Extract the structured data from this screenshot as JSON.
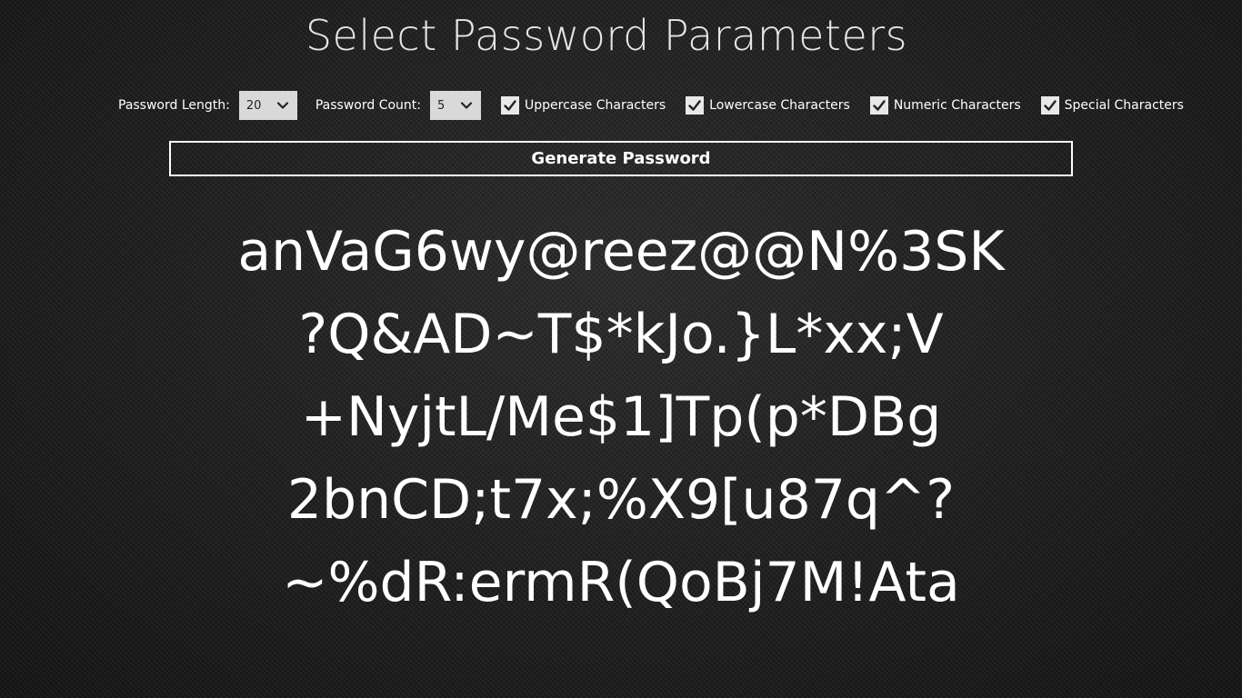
{
  "title": "Select Password Parameters",
  "params": {
    "length_label": "Password Length:",
    "length_value": "20",
    "count_label": "Password Count:",
    "count_value": "5",
    "options": [
      {
        "label": "Uppercase Characters",
        "checked": true
      },
      {
        "label": "Lowercase Characters",
        "checked": true
      },
      {
        "label": "Numeric Characters",
        "checked": true
      },
      {
        "label": "Special Characters",
        "checked": true
      }
    ]
  },
  "generate_label": "Generate Password",
  "passwords": [
    "anVaG6wy@reez@@N%3SK",
    "?Q&AD~T$*kJo.}L*xx;V",
    "+NyjtL/Me$1]Tp(p*DBg",
    "2bnCD;t7x;%X9[u87q^?",
    "~%dR:ermR(QoBj7M!Ata"
  ],
  "icons": {
    "dropdown": "chevron-down-icon",
    "checkbox": "check-icon"
  }
}
